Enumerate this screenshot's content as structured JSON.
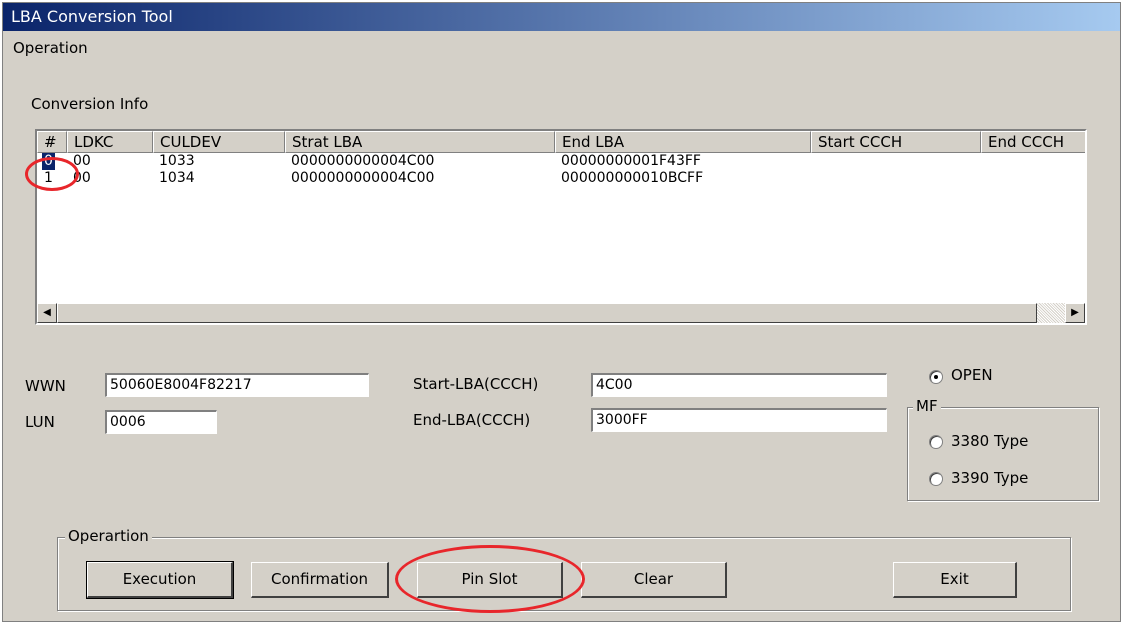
{
  "window": {
    "title": "LBA Conversion Tool"
  },
  "menu": {
    "operation": "Operation"
  },
  "conversion_info": {
    "label": "Conversion Info",
    "columns": [
      "#",
      "LDKC",
      "CULDEV",
      "Strat LBA",
      "End LBA",
      "Start CCCH",
      "End CCCH"
    ],
    "rows": [
      {
        "index": "0",
        "ldkc": "00",
        "culdev": "1033",
        "start_lba": "0000000000004C00",
        "end_lba": "00000000001F43FF"
      },
      {
        "index": "1",
        "ldkc": "00",
        "culdev": "1034",
        "start_lba": "0000000000004C00",
        "end_lba": "000000000010BCFF"
      }
    ]
  },
  "fields": {
    "wwn_label": "WWN",
    "wwn_value": "50060E8004F82217",
    "lun_label": "LUN",
    "lun_value": "0006",
    "start_lba_label": "Start-LBA(CCCH)",
    "start_lba_value": "4C00",
    "end_lba_label": "End-LBA(CCCH)",
    "end_lba_value": "3000FF"
  },
  "type": {
    "open_label": "OPEN",
    "open_selected": true,
    "mf_group_label": "MF",
    "type3380_label": "3380 Type",
    "type3380_selected": false,
    "type3390_label": "3390 Type",
    "type3390_selected": false
  },
  "operation_group": {
    "label": "Operartion",
    "execution": "Execution",
    "confirmation": "Confirmation",
    "pin_slot": "Pin Slot",
    "clear": "Clear",
    "exit": "Exit"
  },
  "annotation_color": "#e8262b"
}
